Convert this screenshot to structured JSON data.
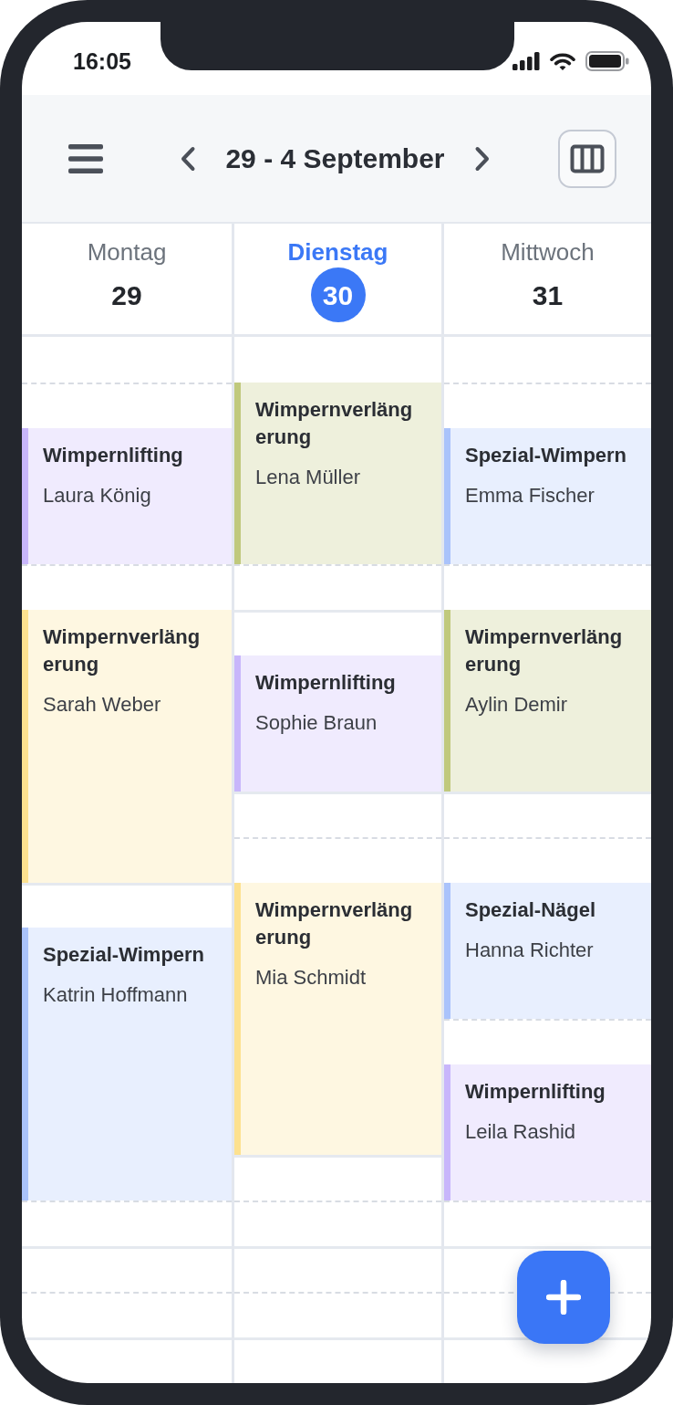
{
  "status_bar": {
    "time": "16:05"
  },
  "toolbar": {
    "title": "29 - 4 September"
  },
  "days": [
    {
      "name": "Montag",
      "date": "29",
      "today": false,
      "events": [
        {
          "service": "Wimpernlifting",
          "client": "Laura König",
          "color": "#c8b6fb"
        },
        {
          "service": "Wimpernverlängerung",
          "client": "Sarah Weber",
          "color": "#fde18f"
        },
        {
          "service": "Spezial-Wimpern",
          "client": "Katrin Hoffmann",
          "color": "#aac3fb"
        }
      ]
    },
    {
      "name": "Dienstag",
      "date": "30",
      "today": true,
      "events": [
        {
          "service": "Wimpernverlängerung",
          "client": "Lena Müller",
          "color": "#c0c97d"
        },
        {
          "service": "Wimpernlifting",
          "client": "Sophie Braun",
          "color": "#c8b6fb"
        },
        {
          "service": "Wimpernverlängerung",
          "client": "Mia Schmidt",
          "color": "#fde18f"
        }
      ]
    },
    {
      "name": "Mittwoch",
      "date": "31",
      "today": false,
      "events": [
        {
          "service": "Spezial-Wimpern",
          "client": "Emma Fischer",
          "color": "#aac3fb"
        },
        {
          "service": "Wimpernverlängerung",
          "client": "Aylin Demir",
          "color": "#c0c97d"
        },
        {
          "service": "Spezial-Nägel",
          "client": "Hanna Richter",
          "color": "#aac3fb"
        },
        {
          "service": "Wimpernlifting",
          "client": "Leila Rashid",
          "color": "#c8b6fb"
        }
      ]
    }
  ]
}
